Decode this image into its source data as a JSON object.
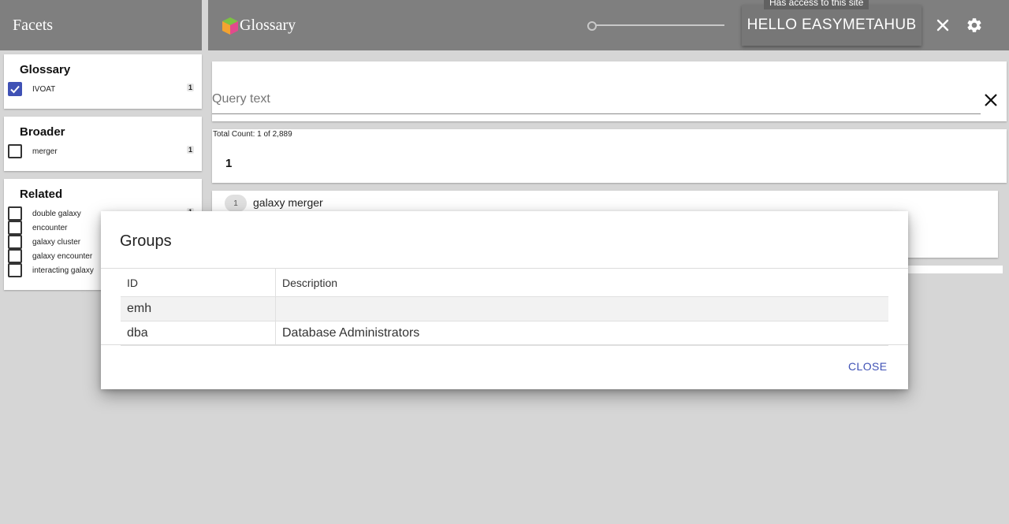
{
  "sidebar": {
    "header": "Facets",
    "glossary": {
      "title": "Glossary",
      "items": [
        {
          "label": "IVOAT",
          "count": "1",
          "checked": true
        }
      ]
    },
    "broader": {
      "title": "Broader",
      "items": [
        {
          "label": "merger",
          "count": "1",
          "checked": false
        }
      ]
    },
    "related": {
      "title": "Related",
      "items": [
        {
          "label": "double galaxy",
          "count": "1",
          "checked": false
        },
        {
          "label": "encounter",
          "checked": false
        },
        {
          "label": "galaxy cluster",
          "checked": false
        },
        {
          "label": "galaxy encounter",
          "checked": false
        },
        {
          "label": "interacting galaxy",
          "checked": false
        }
      ]
    }
  },
  "appbar": {
    "title": "Glossary",
    "user_button": "HELLO EASYMETAHUB",
    "tooltip": "Has access to this site",
    "slider_value": 0,
    "logo_colors": [
      "#f4a330",
      "#7cc242",
      "#e24a8d"
    ]
  },
  "search": {
    "placeholder": "Query text",
    "value": ""
  },
  "results": {
    "total_count": "Total Count: 1 of 2,889",
    "page": "1",
    "items": [
      {
        "index": "1",
        "title": "galaxy merger"
      }
    ]
  },
  "dialog": {
    "title": "Groups",
    "columns": [
      "ID",
      "Description"
    ],
    "rows": [
      {
        "id": "emh",
        "description": ""
      },
      {
        "id": "dba",
        "description": "Database Administrators"
      }
    ],
    "close_label": "CLOSE"
  },
  "colors": {
    "appbar": "#7f7f7f",
    "background": "#d6d6d6",
    "accent": "#3f51b5"
  }
}
